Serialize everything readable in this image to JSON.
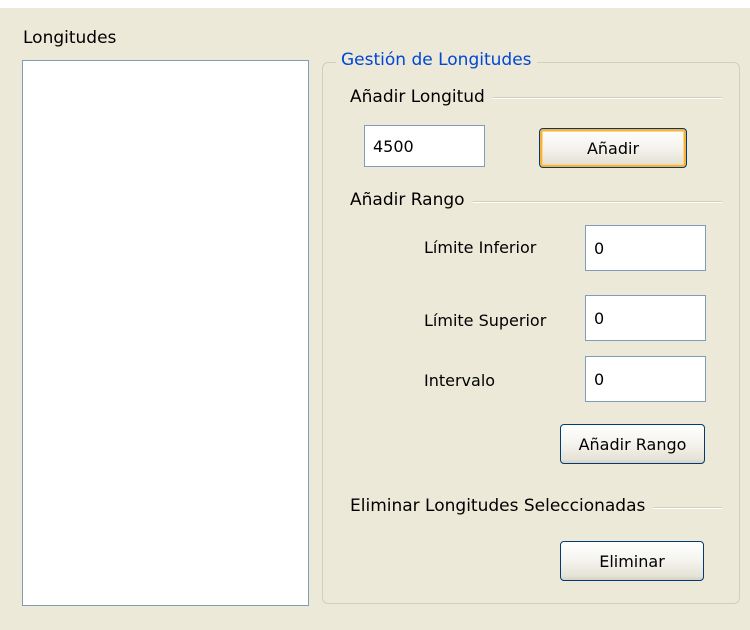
{
  "list_panel": {
    "label": "Longitudes"
  },
  "group": {
    "title": "Gestión de Longitudes",
    "add_length": {
      "section_title": "Añadir Longitud",
      "value": "4500",
      "button_label": "Añadir"
    },
    "add_range": {
      "section_title": "Añadir Rango",
      "fields": [
        {
          "label": "Límite Inferior",
          "value": "0"
        },
        {
          "label": "Límite Superior",
          "value": "0"
        },
        {
          "label": "Intervalo",
          "value": "0"
        }
      ],
      "button_label": "Añadir Rango"
    },
    "remove": {
      "section_title": "Eliminar Longitudes Seleccionadas",
      "button_label": "Eliminar"
    }
  }
}
